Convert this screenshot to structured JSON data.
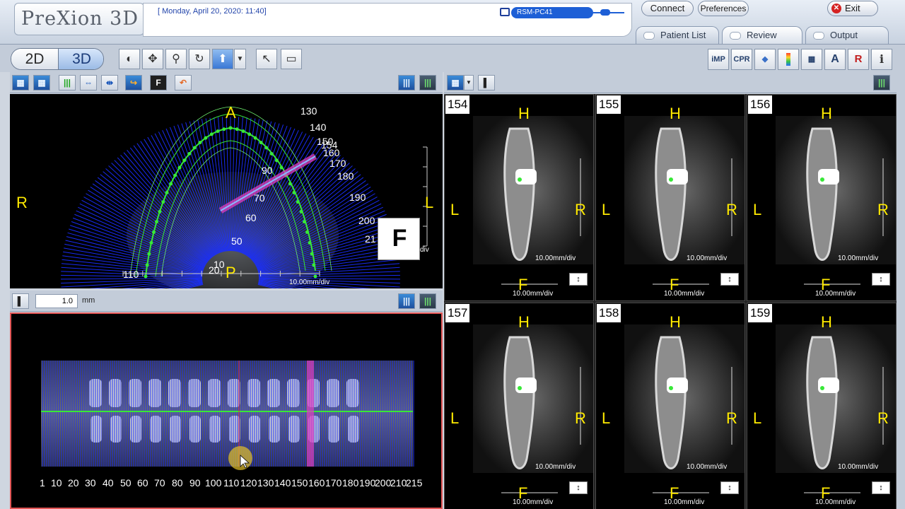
{
  "app": {
    "logo": "PreXion 3D"
  },
  "header": {
    "datetime": "[ Monday, April 20, 2020: 11:40]",
    "pc_name": "RSM-PC41",
    "connect": "Connect",
    "preferences": "Preferences",
    "exit": "Exit"
  },
  "tabs": [
    {
      "label": "Patient List"
    },
    {
      "label": "Review"
    },
    {
      "label": "Output"
    }
  ],
  "toolbar": {
    "mode_2d": "2D",
    "mode_3d": "3D",
    "right_tools": [
      "iMP",
      "CPR",
      "",
      "",
      "",
      "A",
      "R",
      "i"
    ]
  },
  "axial": {
    "labels": {
      "anterior": "A",
      "posterior": "P",
      "right": "R",
      "left": "L"
    },
    "arch_ticks": [
      "130",
      "140",
      "150",
      "154",
      "160",
      "170",
      "180",
      "190",
      "200",
      "21",
      "110",
      "60",
      "50",
      "70",
      "90",
      "20",
      "10"
    ],
    "orientation": "F",
    "scale": "10.00mm/div",
    "right_scale": "div"
  },
  "slab": {
    "value": "1.0",
    "unit": "mm"
  },
  "panoramic": {
    "ticks": [
      "1",
      "10",
      "20",
      "30",
      "40",
      "50",
      "60",
      "70",
      "80",
      "90",
      "100",
      "110",
      "120",
      "130",
      "140",
      "150",
      "160",
      "170",
      "180",
      "190",
      "200",
      "210",
      "215"
    ]
  },
  "cross_sections": [
    {
      "num": "154",
      "top": "H",
      "bottom": "F",
      "left": "L",
      "right": "R",
      "scale": "10.00mm/div",
      "scale_bottom": "10.00mm/div"
    },
    {
      "num": "155",
      "top": "H",
      "bottom": "F",
      "left": "L",
      "right": "R",
      "scale": "10.00mm/div",
      "scale_bottom": "10.00mm/div"
    },
    {
      "num": "156",
      "top": "H",
      "bottom": "F",
      "left": "L",
      "right": "R",
      "scale": "10.00mm/div",
      "scale_bottom": "10.00mm/div"
    },
    {
      "num": "157",
      "top": "H",
      "bottom": "F",
      "left": "L",
      "right": "R",
      "scale": "10.00mm/div",
      "scale_bottom": "10.00mm/div"
    },
    {
      "num": "158",
      "top": "H",
      "bottom": "F",
      "left": "L",
      "right": "R",
      "scale": "10.00mm/div",
      "scale_bottom": "10.00mm/div"
    },
    {
      "num": "159",
      "top": "H",
      "bottom": "F",
      "left": "L",
      "right": "R",
      "scale": "10.00mm/div",
      "scale_bottom": "10.00mm/div"
    }
  ],
  "colors": {
    "overlay_blue": "#1a2eff",
    "curve_green": "#38e838",
    "label_yellow": "#ffea00",
    "cut_pink": "#e040c0"
  }
}
